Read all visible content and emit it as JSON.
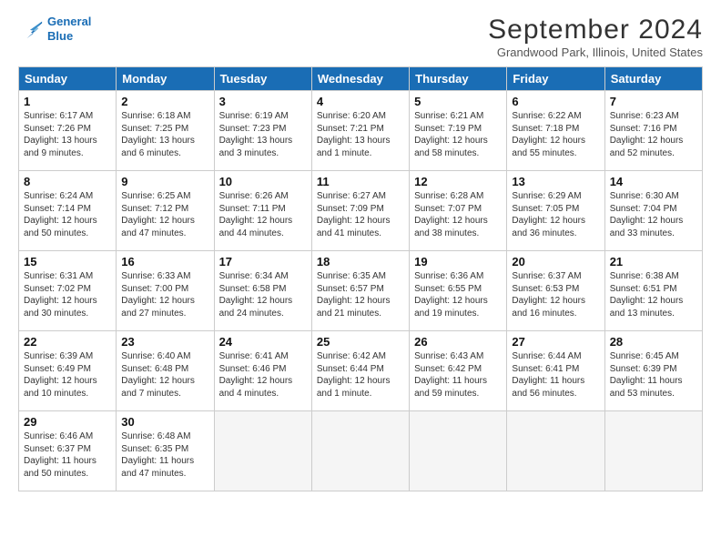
{
  "header": {
    "logo_line1": "General",
    "logo_line2": "Blue",
    "month_title": "September 2024",
    "location": "Grandwood Park, Illinois, United States"
  },
  "days_of_week": [
    "Sunday",
    "Monday",
    "Tuesday",
    "Wednesday",
    "Thursday",
    "Friday",
    "Saturday"
  ],
  "weeks": [
    [
      {
        "num": "1",
        "info": "Sunrise: 6:17 AM\nSunset: 7:26 PM\nDaylight: 13 hours\nand 9 minutes."
      },
      {
        "num": "2",
        "info": "Sunrise: 6:18 AM\nSunset: 7:25 PM\nDaylight: 13 hours\nand 6 minutes."
      },
      {
        "num": "3",
        "info": "Sunrise: 6:19 AM\nSunset: 7:23 PM\nDaylight: 13 hours\nand 3 minutes."
      },
      {
        "num": "4",
        "info": "Sunrise: 6:20 AM\nSunset: 7:21 PM\nDaylight: 13 hours\nand 1 minute."
      },
      {
        "num": "5",
        "info": "Sunrise: 6:21 AM\nSunset: 7:19 PM\nDaylight: 12 hours\nand 58 minutes."
      },
      {
        "num": "6",
        "info": "Sunrise: 6:22 AM\nSunset: 7:18 PM\nDaylight: 12 hours\nand 55 minutes."
      },
      {
        "num": "7",
        "info": "Sunrise: 6:23 AM\nSunset: 7:16 PM\nDaylight: 12 hours\nand 52 minutes."
      }
    ],
    [
      {
        "num": "8",
        "info": "Sunrise: 6:24 AM\nSunset: 7:14 PM\nDaylight: 12 hours\nand 50 minutes."
      },
      {
        "num": "9",
        "info": "Sunrise: 6:25 AM\nSunset: 7:12 PM\nDaylight: 12 hours\nand 47 minutes."
      },
      {
        "num": "10",
        "info": "Sunrise: 6:26 AM\nSunset: 7:11 PM\nDaylight: 12 hours\nand 44 minutes."
      },
      {
        "num": "11",
        "info": "Sunrise: 6:27 AM\nSunset: 7:09 PM\nDaylight: 12 hours\nand 41 minutes."
      },
      {
        "num": "12",
        "info": "Sunrise: 6:28 AM\nSunset: 7:07 PM\nDaylight: 12 hours\nand 38 minutes."
      },
      {
        "num": "13",
        "info": "Sunrise: 6:29 AM\nSunset: 7:05 PM\nDaylight: 12 hours\nand 36 minutes."
      },
      {
        "num": "14",
        "info": "Sunrise: 6:30 AM\nSunset: 7:04 PM\nDaylight: 12 hours\nand 33 minutes."
      }
    ],
    [
      {
        "num": "15",
        "info": "Sunrise: 6:31 AM\nSunset: 7:02 PM\nDaylight: 12 hours\nand 30 minutes."
      },
      {
        "num": "16",
        "info": "Sunrise: 6:33 AM\nSunset: 7:00 PM\nDaylight: 12 hours\nand 27 minutes."
      },
      {
        "num": "17",
        "info": "Sunrise: 6:34 AM\nSunset: 6:58 PM\nDaylight: 12 hours\nand 24 minutes."
      },
      {
        "num": "18",
        "info": "Sunrise: 6:35 AM\nSunset: 6:57 PM\nDaylight: 12 hours\nand 21 minutes."
      },
      {
        "num": "19",
        "info": "Sunrise: 6:36 AM\nSunset: 6:55 PM\nDaylight: 12 hours\nand 19 minutes."
      },
      {
        "num": "20",
        "info": "Sunrise: 6:37 AM\nSunset: 6:53 PM\nDaylight: 12 hours\nand 16 minutes."
      },
      {
        "num": "21",
        "info": "Sunrise: 6:38 AM\nSunset: 6:51 PM\nDaylight: 12 hours\nand 13 minutes."
      }
    ],
    [
      {
        "num": "22",
        "info": "Sunrise: 6:39 AM\nSunset: 6:49 PM\nDaylight: 12 hours\nand 10 minutes."
      },
      {
        "num": "23",
        "info": "Sunrise: 6:40 AM\nSunset: 6:48 PM\nDaylight: 12 hours\nand 7 minutes."
      },
      {
        "num": "24",
        "info": "Sunrise: 6:41 AM\nSunset: 6:46 PM\nDaylight: 12 hours\nand 4 minutes."
      },
      {
        "num": "25",
        "info": "Sunrise: 6:42 AM\nSunset: 6:44 PM\nDaylight: 12 hours\nand 1 minute."
      },
      {
        "num": "26",
        "info": "Sunrise: 6:43 AM\nSunset: 6:42 PM\nDaylight: 11 hours\nand 59 minutes."
      },
      {
        "num": "27",
        "info": "Sunrise: 6:44 AM\nSunset: 6:41 PM\nDaylight: 11 hours\nand 56 minutes."
      },
      {
        "num": "28",
        "info": "Sunrise: 6:45 AM\nSunset: 6:39 PM\nDaylight: 11 hours\nand 53 minutes."
      }
    ],
    [
      {
        "num": "29",
        "info": "Sunrise: 6:46 AM\nSunset: 6:37 PM\nDaylight: 11 hours\nand 50 minutes."
      },
      {
        "num": "30",
        "info": "Sunrise: 6:48 AM\nSunset: 6:35 PM\nDaylight: 11 hours\nand 47 minutes."
      },
      {
        "num": "",
        "info": "",
        "empty": true
      },
      {
        "num": "",
        "info": "",
        "empty": true
      },
      {
        "num": "",
        "info": "",
        "empty": true
      },
      {
        "num": "",
        "info": "",
        "empty": true
      },
      {
        "num": "",
        "info": "",
        "empty": true
      }
    ]
  ]
}
